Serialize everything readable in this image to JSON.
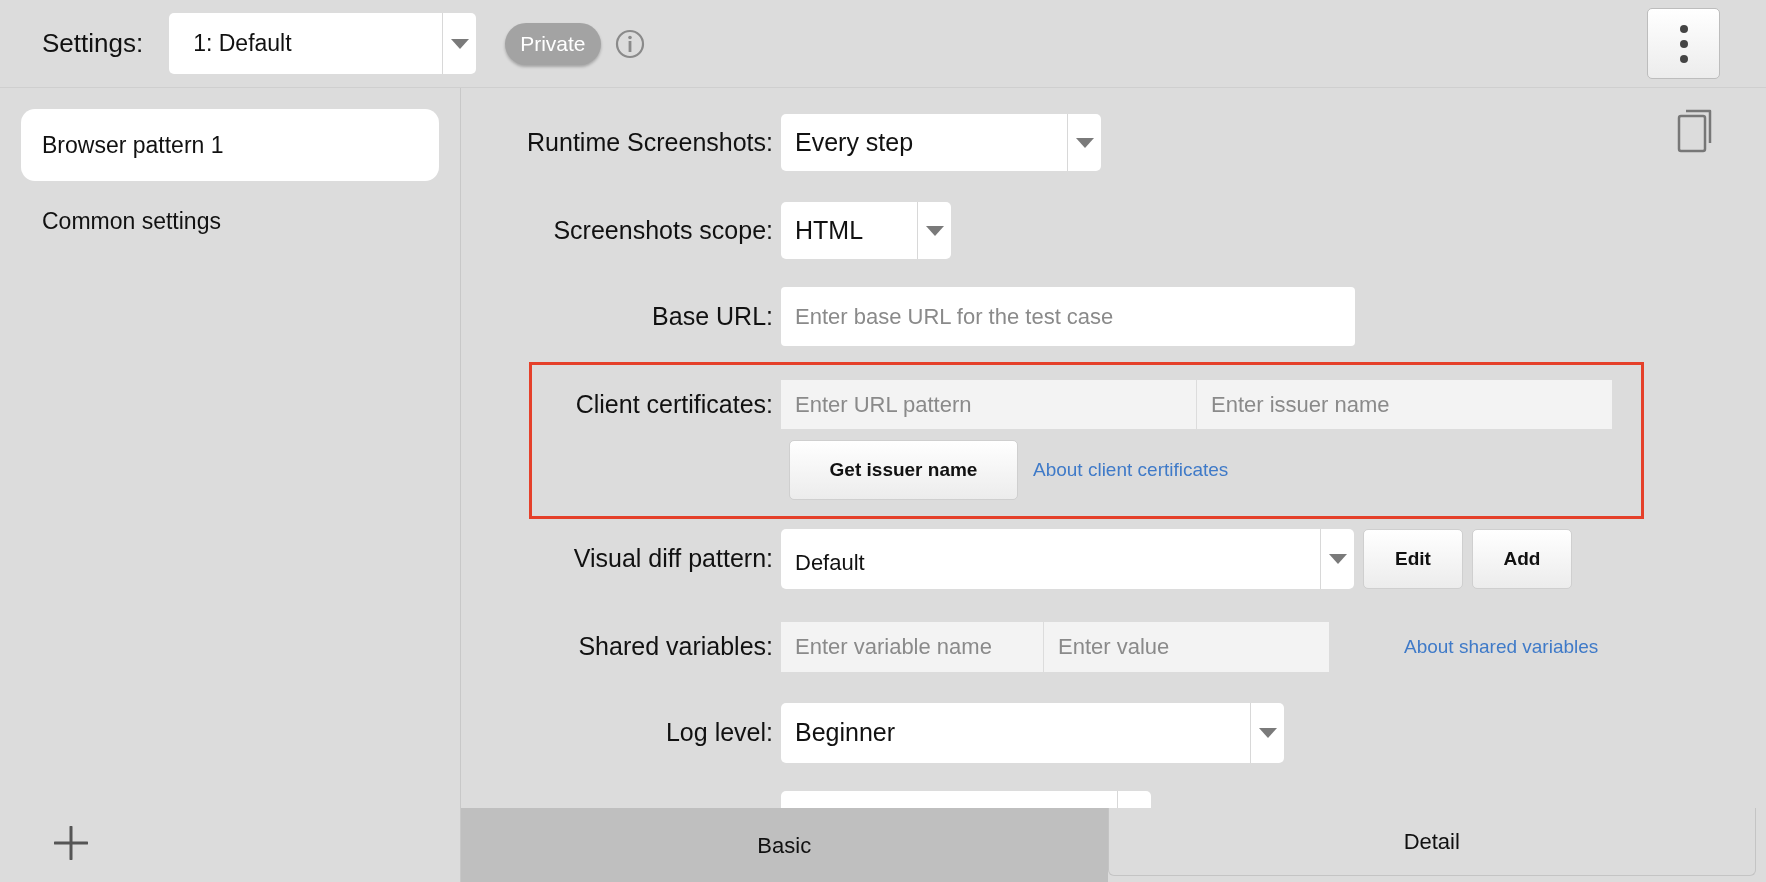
{
  "header": {
    "label": "Settings:",
    "settings_select": {
      "value": "1: Default"
    },
    "badge": "Private"
  },
  "sidebar": {
    "items": [
      {
        "label": "Browser pattern 1",
        "selected": true
      },
      {
        "label": "Common settings",
        "selected": false
      }
    ]
  },
  "form": {
    "fields": [
      {
        "kind": "select",
        "label": "Runtime Screenshots:",
        "value": "Every step"
      },
      {
        "kind": "select",
        "label": "Screenshots scope:",
        "value": "HTML"
      },
      {
        "kind": "input",
        "label": "Base URL:",
        "placeholder": "Enter base URL for the test case"
      },
      {
        "kind": "certificates",
        "label": "Client certificates:",
        "placeholders": [
          "Enter URL pattern",
          "Enter issuer name"
        ],
        "button": "Get issuer name",
        "link": "About client certificates",
        "highlighted": true
      },
      {
        "kind": "select_buttons",
        "label": "Visual diff pattern:",
        "value": "Default",
        "buttons": [
          "Edit",
          "Add"
        ]
      },
      {
        "kind": "pair",
        "label": "Shared variables:",
        "placeholders": [
          "Enter variable name",
          "Enter value"
        ],
        "link": "About shared variables"
      },
      {
        "kind": "select",
        "label": "Log level:",
        "value": "Beginner"
      },
      {
        "kind": "select"
      }
    ]
  },
  "tabs": [
    {
      "label": "Basic",
      "selected": true
    },
    {
      "label": "Detail",
      "selected": false
    }
  ]
}
